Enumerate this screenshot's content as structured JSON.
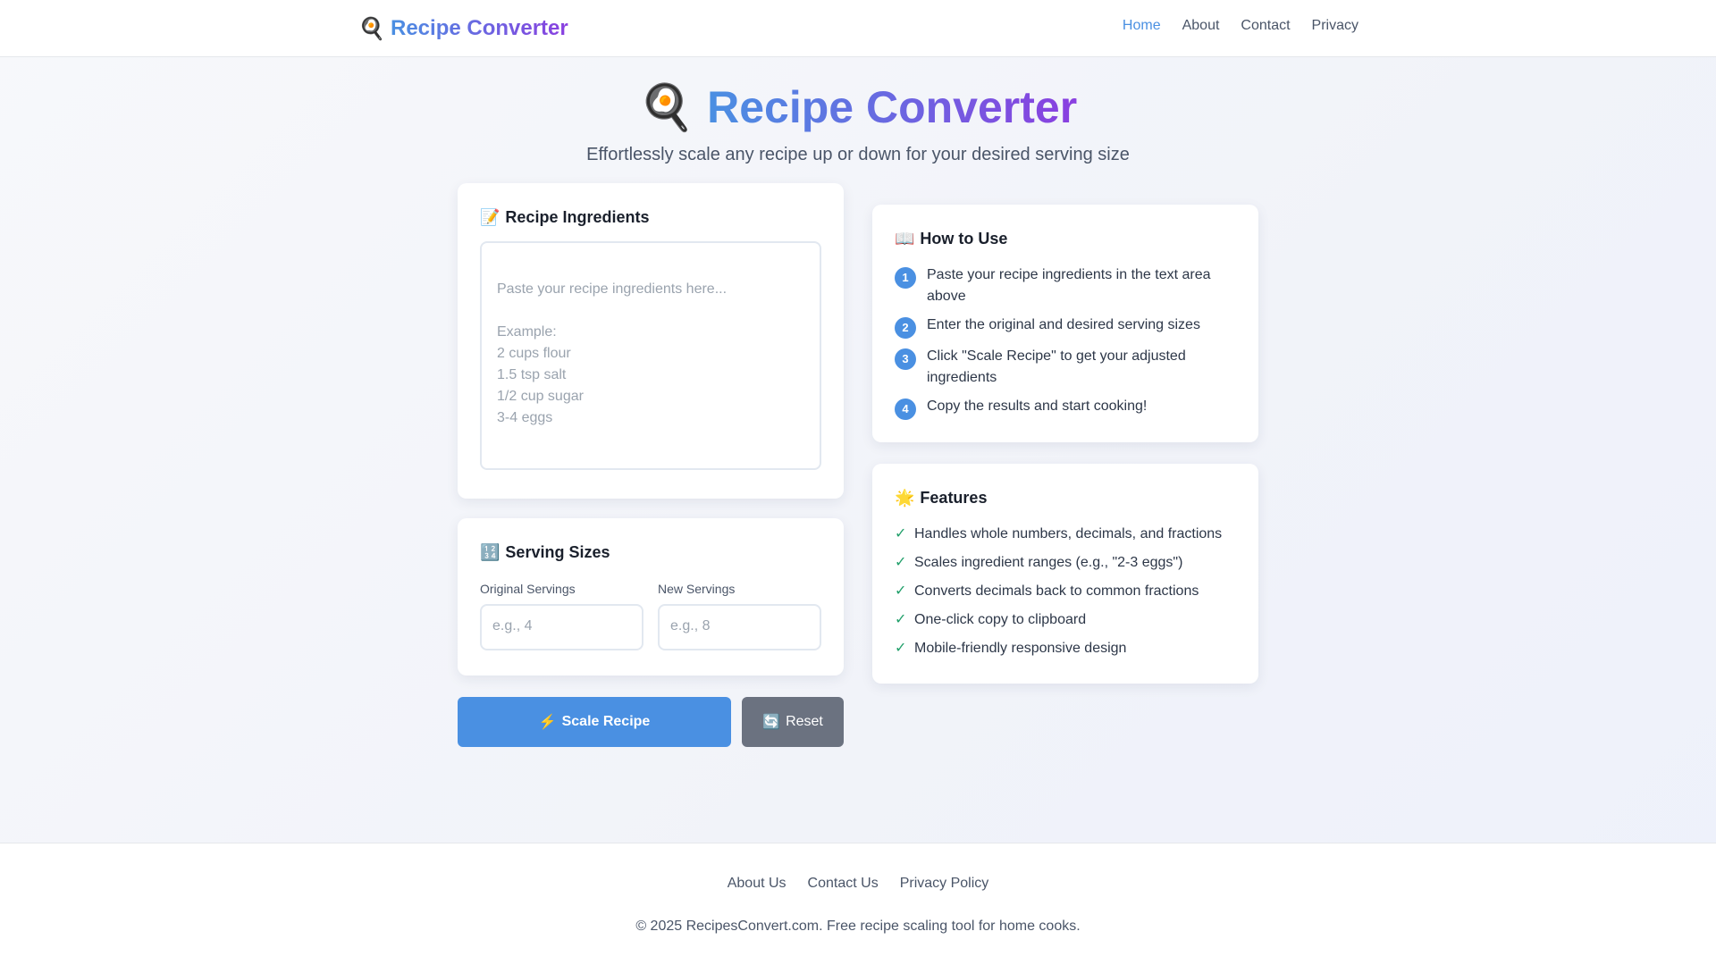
{
  "nav": {
    "brand_icon": "frying-pan-egg-icon",
    "brand_glyph": "🍳",
    "brand_text": "Recipe Converter",
    "links": [
      {
        "label": "Home",
        "active": true
      },
      {
        "label": "About",
        "active": false
      },
      {
        "label": "Contact",
        "active": false
      },
      {
        "label": "Privacy",
        "active": false
      }
    ]
  },
  "hero": {
    "icon_glyph": "🍳",
    "title": "Recipe Converter",
    "subtitle": "Effortlessly scale any recipe up or down for your desired serving size"
  },
  "ingredients": {
    "icon_glyph": "📝",
    "heading": "Recipe Ingredients",
    "value": "",
    "placeholder": "Paste your recipe ingredients here...\n\nExample:\n2 cups flour\n1.5 tsp salt\n1/2 cup sugar\n3-4 eggs"
  },
  "servings": {
    "icon_glyph": "🔢",
    "heading": "Serving Sizes",
    "original_label": "Original Servings",
    "original_placeholder": "e.g., 4",
    "new_label": "New Servings",
    "new_placeholder": "e.g., 8"
  },
  "actions": {
    "scale_icon": "⚡",
    "scale_label": "Scale Recipe",
    "reset_icon": "🔄",
    "reset_label": "Reset"
  },
  "howto": {
    "icon_glyph": "📖",
    "heading": "How to Use",
    "steps": [
      {
        "num": "1",
        "text": "Paste your recipe ingredients in the text area above"
      },
      {
        "num": "2",
        "text": "Enter the original and desired serving sizes"
      },
      {
        "num": "3",
        "text": "Click \"Scale Recipe\" to get your adjusted ingredients"
      },
      {
        "num": "4",
        "text": "Copy the results and start cooking!"
      }
    ]
  },
  "features": {
    "icon_glyph": "🌟",
    "heading": "Features",
    "check_glyph": "✓",
    "items": [
      "Handles whole numbers, decimals, and fractions",
      "Scales ingredient ranges (e.g., \"2-3 eggs\")",
      "Converts decimals back to common fractions",
      "One-click copy to clipboard",
      "Mobile-friendly responsive design"
    ]
  },
  "footer": {
    "links": [
      "About Us",
      "Contact Us",
      "Privacy Policy"
    ],
    "copyright": "© 2025 RecipesConvert.com. Free recipe scaling tool for home cooks."
  },
  "colors": {
    "accent_blue": "#4a90e2",
    "accent_purple": "#8a3fe0",
    "reset_gray": "#6b7280",
    "check_green": "#22a06b"
  }
}
